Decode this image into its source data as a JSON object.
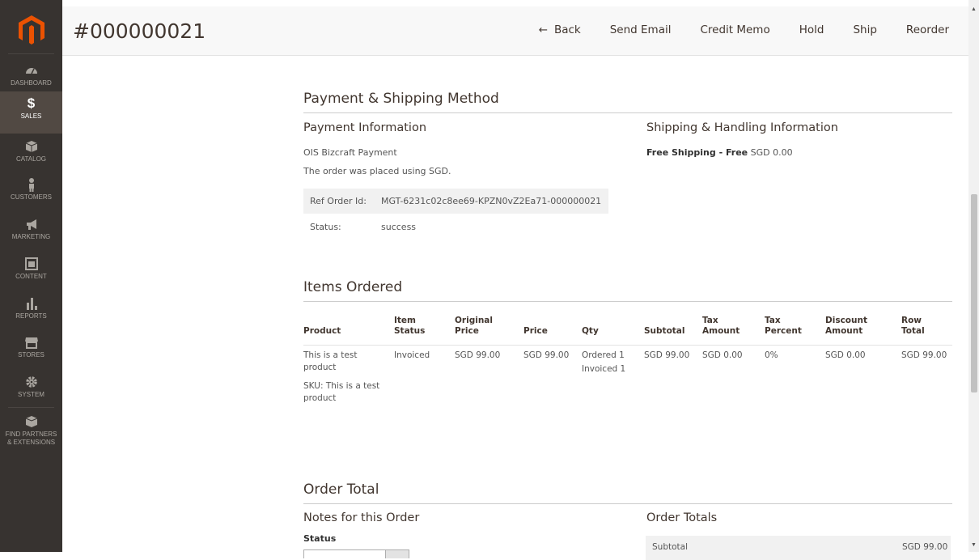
{
  "sidebar": {
    "items": [
      {
        "label": "Dashboard",
        "icon": "dashboard-icon"
      },
      {
        "label": "Sales",
        "icon": "dollar-icon"
      },
      {
        "label": "Catalog",
        "icon": "catalog-box-icon"
      },
      {
        "label": "Customers",
        "icon": "customer-person-icon"
      },
      {
        "label": "Marketing",
        "icon": "megaphone-icon"
      },
      {
        "label": "Content",
        "icon": "content-layout-icon"
      },
      {
        "label": "Reports",
        "icon": "bar-chart-icon"
      },
      {
        "label": "Stores",
        "icon": "storefront-icon"
      },
      {
        "label": "System",
        "icon": "gear-icon"
      },
      {
        "label": "Find Partners & Extensions",
        "label_line1": "Find Partners",
        "label_line2": "& Extensions",
        "icon": "partners-box-icon"
      }
    ],
    "active": "Sales"
  },
  "header": {
    "title": "#000000021",
    "actions": {
      "back": "Back",
      "send_email": "Send Email",
      "credit_memo": "Credit Memo",
      "hold": "Hold",
      "ship": "Ship",
      "reorder": "Reorder"
    }
  },
  "payment_shipping": {
    "section_title": "Payment & Shipping Method",
    "payment_title": "Payment Information",
    "payment_method": "OIS Bizcraft Payment",
    "currency_note": "The order was placed using SGD.",
    "ref_label": "Ref Order Id:",
    "ref_value": "MGT-6231c02c8ee69-KPZN0vZ2Ea71-000000021",
    "status_label": "Status:",
    "status_value": "success",
    "shipping_title": "Shipping & Handling Information",
    "shipping_method": "Free Shipping - Free",
    "shipping_price": "SGD 0.00"
  },
  "items": {
    "section_title": "Items Ordered",
    "headers": {
      "product": "Product",
      "item_status_1": "Item",
      "item_status_2": "Status",
      "original_price_1": "Original",
      "original_price_2": "Price",
      "price": "Price",
      "qty": "Qty",
      "subtotal": "Subtotal",
      "tax_amount_1": "Tax",
      "tax_amount_2": "Amount",
      "tax_percent_1": "Tax",
      "tax_percent_2": "Percent",
      "discount_1": "Discount",
      "discount_2": "Amount",
      "row_total_1": "Row",
      "row_total_2": "Total"
    },
    "rows": [
      {
        "product_line1": "This is a test",
        "product_line2": "product",
        "sku_line1": "SKU: This is a test",
        "sku_line2": "product",
        "status": "Invoiced",
        "original_price": "SGD 99.00",
        "price": "SGD 99.00",
        "qty_ordered": "Ordered 1",
        "qty_invoiced": "Invoiced 1",
        "subtotal": "SGD 99.00",
        "tax_amount": "SGD 0.00",
        "tax_percent": "0%",
        "discount": "SGD 0.00",
        "row_total": "SGD 99.00"
      }
    ]
  },
  "order_total": {
    "section_title": "Order Total",
    "notes_title": "Notes for this Order",
    "status_label": "Status",
    "totals_title": "Order Totals",
    "subtotal_label": "Subtotal",
    "subtotal_value": "SGD 99.00"
  }
}
